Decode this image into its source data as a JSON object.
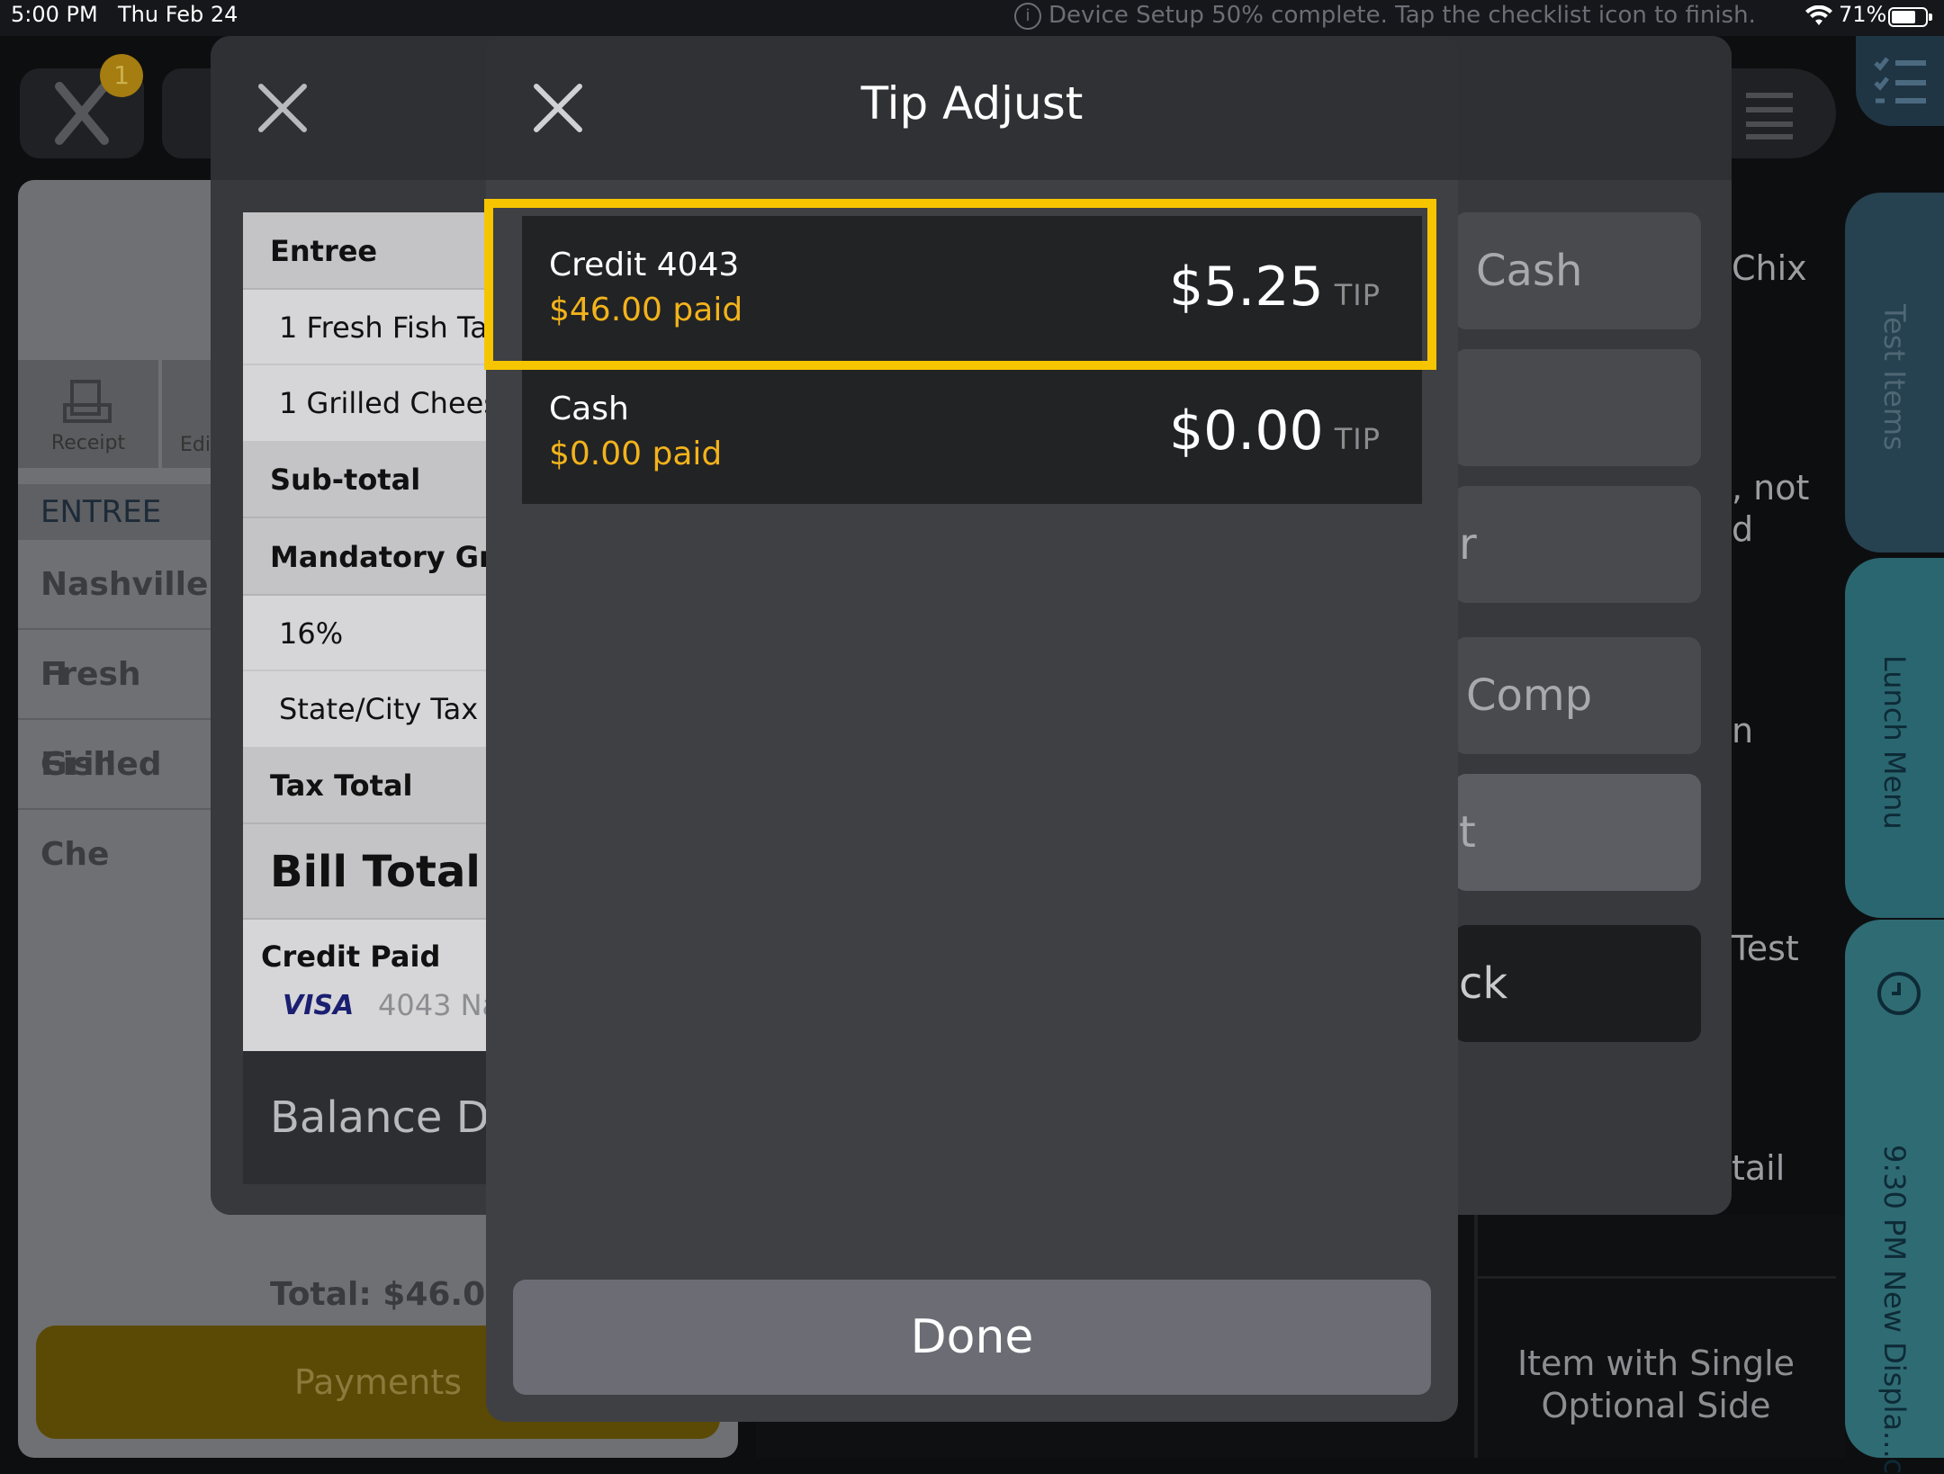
{
  "status_bar": {
    "time": "5:00 PM",
    "date": "Thu Feb 24",
    "notice": "Device Setup 50% complete. Tap the checklist icon to finish.",
    "battery": "71%"
  },
  "background": {
    "badge_count": "1",
    "receipt_label": "Receipt",
    "edit_label": "Edi",
    "entree_header": "ENTREE",
    "menu_items": [
      "Nashville H",
      "Fresh Fish",
      "Grilled Che"
    ],
    "total": "Total: $46.00",
    "payments_label": "Payments",
    "right_texts": [
      "Chix",
      ", not",
      "d",
      "n",
      "Test",
      "tail"
    ],
    "grid_item": "Item with Single Optional Side",
    "side_tabs": [
      "Test Items",
      "Lunch Menu",
      "9:30 PM New Displa...c"
    ]
  },
  "payment_modal": {
    "sections": {
      "entree": "Entree",
      "items": [
        "1 Fresh Fish Tac",
        "1 Grilled Chees"
      ],
      "subtotal": "Sub-total",
      "mandatory": "Mandatory Gra",
      "pct": "16%",
      "tax_line": "State/City Tax",
      "tax_total": "Tax Total",
      "bill_total": "Bill Total",
      "credit_paid": "Credit Paid",
      "card_brand": "VISA",
      "card_detail": "4043 Na",
      "balance_due": "Balance Du"
    },
    "buttons": [
      "Cash",
      "",
      "r",
      "Comp",
      "t",
      "ck"
    ]
  },
  "tip_adjust": {
    "title": "Tip Adjust",
    "payments": [
      {
        "name": "Credit 4043",
        "paid": "$46.00 paid",
        "tip": "$5.25",
        "tip_label": "TIP",
        "highlighted": true
      },
      {
        "name": "Cash",
        "paid": "$0.00 paid",
        "tip": "$0.00",
        "tip_label": "TIP",
        "highlighted": false
      }
    ],
    "done_label": "Done"
  },
  "colors": {
    "accent_paid": "#f2b31b",
    "highlight": "#f6c500",
    "side_tab": "#2f6b73"
  }
}
